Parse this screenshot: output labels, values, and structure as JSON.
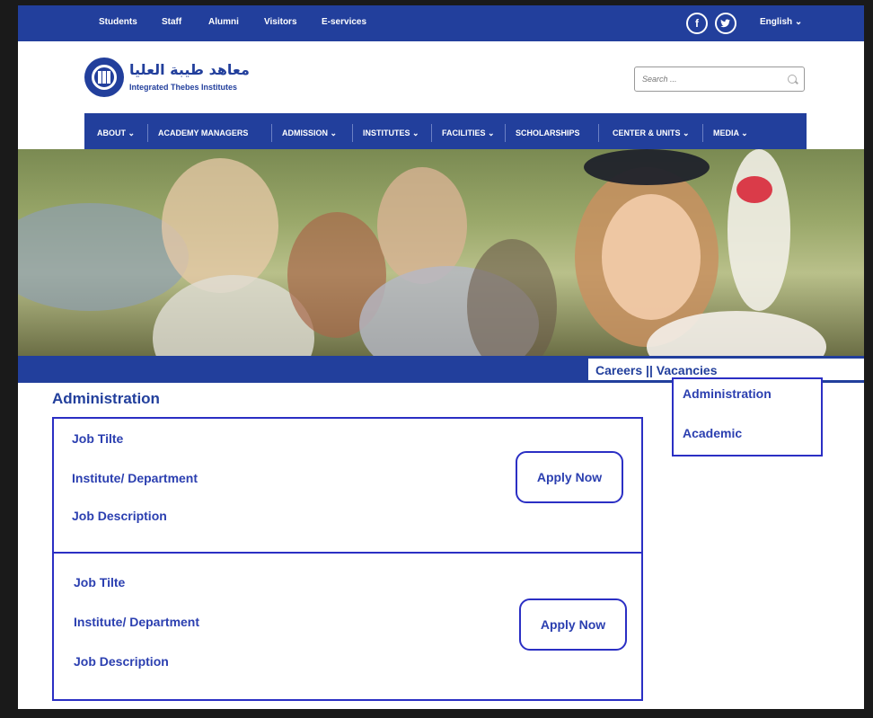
{
  "topbar": {
    "links": [
      "Students",
      "Staff",
      "Alumni",
      "Visitors",
      "E-services"
    ],
    "social": [
      "f",
      "t"
    ],
    "language": "English ⌄"
  },
  "logo": {
    "arabic": "معاهد طيبة العليا",
    "english": "Integrated Thebes Institutes"
  },
  "search": {
    "placeholder": "Search ..."
  },
  "nav": {
    "items": [
      "ABOUT ⌄",
      "ACADEMY MANAGERS",
      "ADMISSION ⌄",
      "INSTITUTES ⌄",
      "FACILITIES ⌄",
      "SCHOLARSHIPS",
      "CENTER & UNITS ⌄",
      "MEDIA ⌄"
    ]
  },
  "careers": {
    "label": "Careers   || Vacancies",
    "dropdown": [
      "Administration",
      "Academic"
    ]
  },
  "section": {
    "title": "Administration"
  },
  "jobs": [
    {
      "title": "Job Tilte",
      "department": "Institute/ Department",
      "description": "Job Description",
      "apply": "Apply Now"
    },
    {
      "title": "Job Tilte",
      "department": "Institute/ Department",
      "description": "Job Description",
      "apply": "Apply Now"
    }
  ],
  "colors": {
    "brand": "#223f9c",
    "outline": "#2b2fc4"
  }
}
